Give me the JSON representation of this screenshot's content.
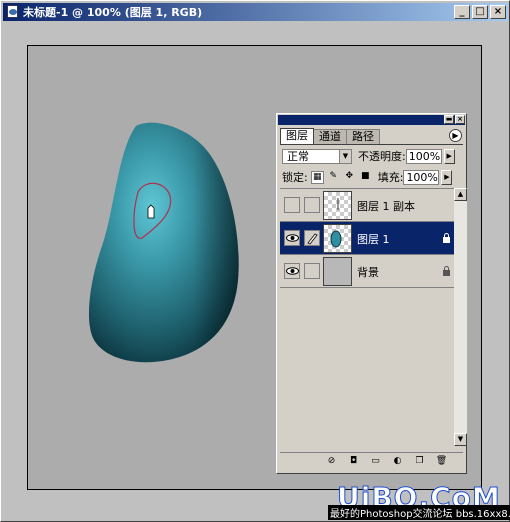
{
  "window": {
    "title": "未标题-1 @ 100% (图层 1, RGB)",
    "min_label": "_",
    "max_label": "□",
    "close_label": "×",
    "icon": "photoshop-document-icon"
  },
  "layers_palette": {
    "tabs": [
      {
        "label": "图层",
        "active": true
      },
      {
        "label": "通道",
        "active": false
      },
      {
        "label": "路径",
        "active": false
      }
    ],
    "blend_mode": "正常",
    "opacity_label": "不透明度:",
    "opacity_value": "100%",
    "lock_label": "锁定:",
    "fill_label": "填充:",
    "fill_value": "100%",
    "layers": [
      {
        "name": "图层 1 副本",
        "visible": false,
        "selected": false,
        "thumbnail": "transparent-with-line",
        "locked": false
      },
      {
        "name": "图层 1",
        "visible": true,
        "selected": true,
        "thumbnail": "transparent-with-shape",
        "locked": true
      },
      {
        "name": "背景",
        "visible": true,
        "selected": false,
        "thumbnail": "gray",
        "locked": true
      }
    ],
    "bottom_icons": [
      "layer-style-icon",
      "mask-icon",
      "new-set-icon",
      "adjustment-layer-icon",
      "new-layer-icon",
      "trash-icon"
    ]
  },
  "colors": {
    "titlebar_start": "#0a246a",
    "titlebar_end": "#a6caf0",
    "shape_light": "#4fb4c4",
    "shape_dark": "#0c3a44",
    "selection": "#0a246a"
  },
  "watermark": {
    "brand": "UiBQ.CoM",
    "sub": "最好的Photoshop交流论坛 bbs.16xx8.com"
  }
}
